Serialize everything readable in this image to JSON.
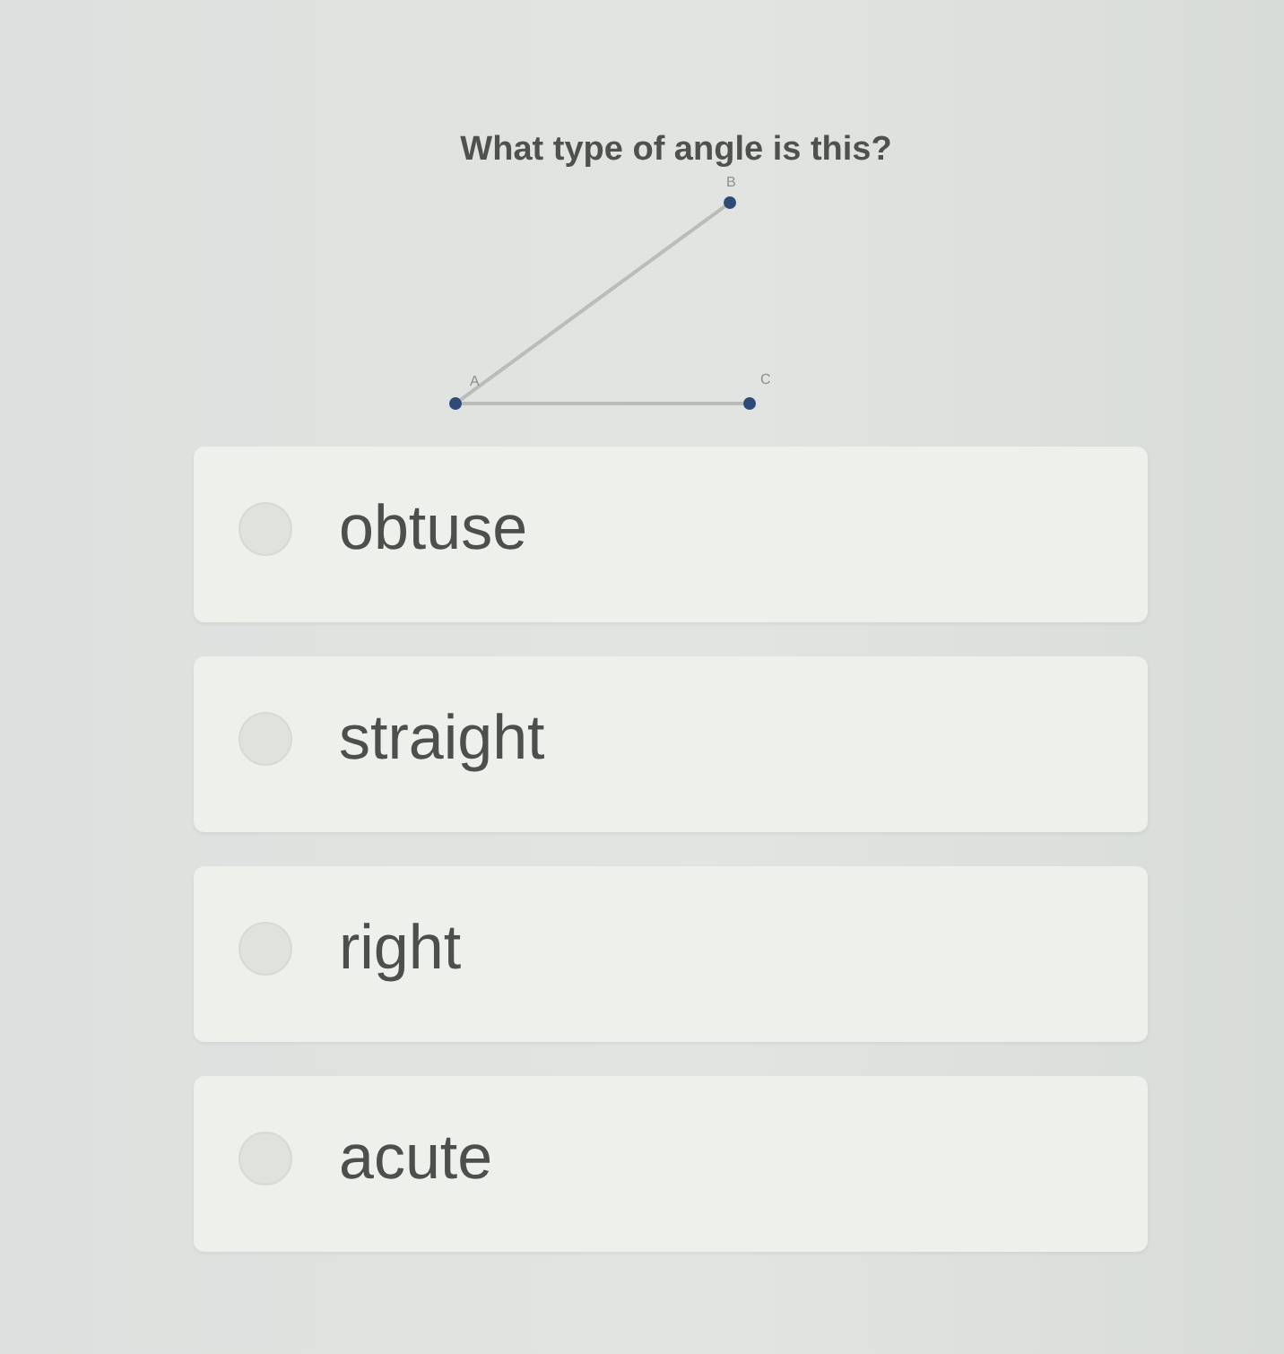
{
  "question": {
    "text": "What type of angle is this?"
  },
  "diagram": {
    "points": [
      {
        "label": "B"
      },
      {
        "label": "A"
      },
      {
        "label": "C"
      }
    ]
  },
  "choices": [
    {
      "label": "obtuse",
      "selected": false
    },
    {
      "label": "straight",
      "selected": false
    },
    {
      "label": "right",
      "selected": false
    },
    {
      "label": "acute",
      "selected": false
    }
  ]
}
